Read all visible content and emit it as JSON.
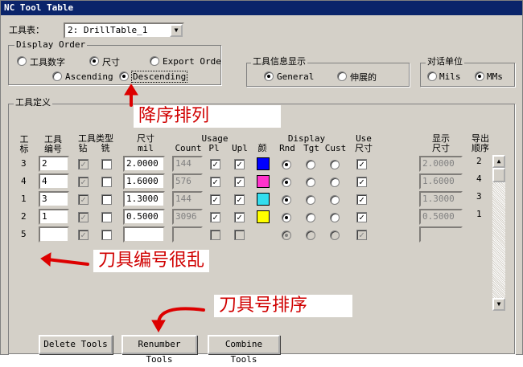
{
  "window": {
    "title": "NC Tool Table"
  },
  "tool_table": {
    "label": "工具表：",
    "value": "2: DrillTable_1"
  },
  "display_order": {
    "legend": "Display Order",
    "options": [
      "工具数字",
      "尺寸",
      "Export Orde",
      "Ascending",
      "Descending"
    ],
    "selected_sort": "尺寸",
    "selected_direction": "Descending"
  },
  "tool_info": {
    "legend": "工具信息显示",
    "options": [
      "General",
      "伸展的"
    ],
    "selected": "General"
  },
  "units": {
    "legend": "对话单位",
    "options": [
      "Mils",
      "MMs"
    ],
    "selected": "MMs"
  },
  "tool_def": {
    "legend": "工具定义",
    "headers": {
      "idx": "工\n标",
      "num": "工具\n编号",
      "type_top": "工具类型",
      "drill": "钻",
      "mill": "铣",
      "size_top": "尺寸",
      "size_unit": "mil",
      "usage_top": "Usage",
      "count": "Count",
      "pl": "Pl",
      "upl": "Upl",
      "color": "颜",
      "display_top": "Display",
      "rnd": "Rnd",
      "tgt": "Tgt",
      "cust": "Cust",
      "use_top": "Use",
      "use_size": "尺寸",
      "disp_size": "显示\n尺寸",
      "order": "导出\n顺序"
    },
    "rows": [
      {
        "idx": "3",
        "num": "2",
        "size": "2.0000",
        "count": "144",
        "color": "#0000ff",
        "disp_size": "2.0000",
        "order": "2"
      },
      {
        "idx": "4",
        "num": "4",
        "size": "1.6000",
        "count": "576",
        "color": "#ff33cc",
        "disp_size": "1.6000",
        "order": "4"
      },
      {
        "idx": "1",
        "num": "3",
        "size": "1.3000",
        "count": "144",
        "color": "#33ddee",
        "disp_size": "1.3000",
        "order": "3"
      },
      {
        "idx": "2",
        "num": "1",
        "size": "0.5000",
        "count": "3096",
        "color": "#ffff00",
        "disp_size": "0.5000",
        "order": "1"
      },
      {
        "idx": "5",
        "num": "",
        "size": "",
        "count": "",
        "color": "",
        "disp_size": "",
        "order": ""
      }
    ]
  },
  "buttons": {
    "delete": "Delete Tools",
    "renumber": "Renumber Tools",
    "combine": "Combine Tools"
  },
  "annotations": {
    "descending": "降序排列",
    "tool_number": "刀具编号很乱",
    "renumber": "刀具号排序",
    "color": "#dd0000"
  }
}
